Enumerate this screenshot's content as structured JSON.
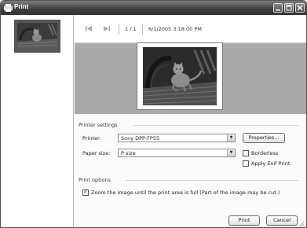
{
  "window": {
    "title": "Print"
  },
  "toolbar": {
    "first_icon": "skip-back-icon",
    "next_icon": "skip-forward-icon",
    "page_counter": "1 / 1",
    "date": "6/1/2005 3:18:00 PM"
  },
  "printer_settings": {
    "heading": "Printer settings",
    "printer_label": "Printer:",
    "printer_value": "Sony DPP-FP55",
    "properties_button": "Properties...",
    "paper_size_label": "Paper size:",
    "paper_size_value": "P size",
    "borderless_label": "Borderless",
    "borderless_checked": false,
    "apply_exif_label": "Apply Exif Print",
    "apply_exif_checked": false
  },
  "print_options": {
    "heading": "Print options",
    "zoom_label": "Zoom the image until the print area is full (Part of the image may be cut.)",
    "zoom_checked": true
  },
  "footer": {
    "print_button": "Print",
    "cancel_button": "Cancel"
  },
  "colors": {
    "titlebar": "#3d3d3d",
    "preview_bg": "#a9a9a9"
  }
}
